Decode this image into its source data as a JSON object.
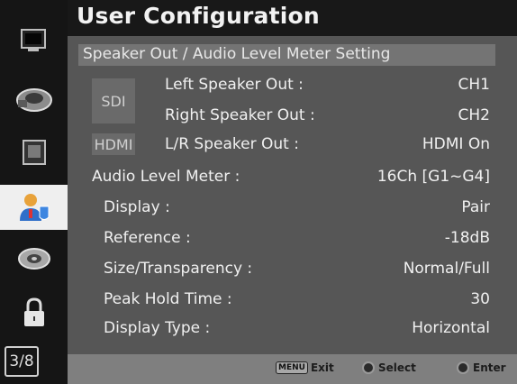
{
  "header": {
    "title": "User Configuration"
  },
  "section": {
    "title": "Speaker Out / Audio Level Meter Setting"
  },
  "sidebar": {
    "icons": [
      "monitor-icon",
      "lens-icon",
      "display-icon",
      "user-config-icon",
      "disc-icon",
      "lock-icon"
    ],
    "active_index": 3,
    "page_indicator": "3/8"
  },
  "speaker": {
    "sdi_tag": "SDI",
    "hdmi_tag": "HDMI",
    "rows": [
      {
        "label": "Left Speaker Out :",
        "value": "CH1"
      },
      {
        "label": "Right Speaker Out :",
        "value": "CH2"
      },
      {
        "label": "L/R Speaker Out :",
        "value": "HDMI On"
      }
    ]
  },
  "meter": {
    "label": "Audio Level Meter :",
    "value": "16Ch [G1~G4]",
    "rows": [
      {
        "label": "Display :",
        "value": "Pair"
      },
      {
        "label": "Reference :",
        "value": "-18dB"
      },
      {
        "label": "Size/Transparency :",
        "value": "Normal/Full"
      },
      {
        "label": "Peak Hold Time :",
        "value": "30"
      },
      {
        "label": "Display Type :",
        "value": "Horizontal"
      }
    ]
  },
  "footer": {
    "menu_key": "MENU",
    "exit_label": "Exit",
    "select_label": "Select",
    "enter_label": "Enter"
  }
}
